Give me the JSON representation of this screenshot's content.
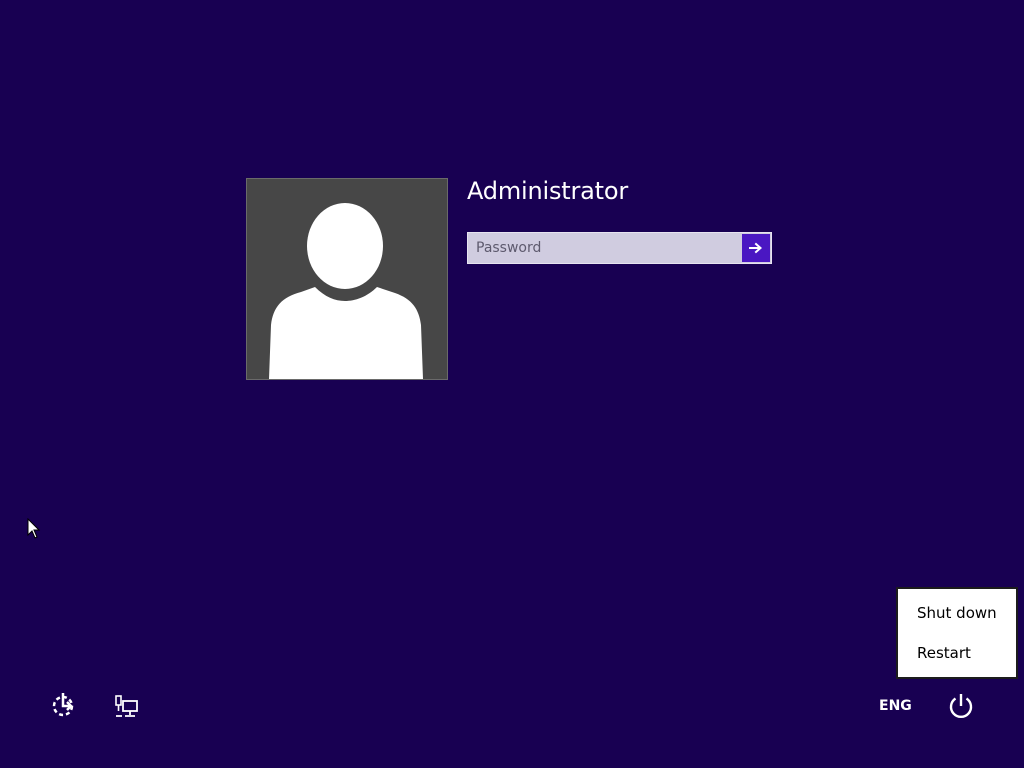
{
  "user": {
    "name": "Administrator",
    "avatar_icon": "user-silhouette-icon"
  },
  "password": {
    "value": "",
    "placeholder": "Password",
    "submit_icon": "arrow-right-icon"
  },
  "power_menu": {
    "items": [
      {
        "label": "Shut down"
      },
      {
        "label": "Restart"
      }
    ]
  },
  "bottom_bar": {
    "ease_of_access_icon": "ease-of-access-icon",
    "network_icon": "network-icon",
    "language": "ENG",
    "power_icon": "power-icon"
  },
  "colors": {
    "background": "#180052",
    "accent": "#4a17c2",
    "avatar_bg": "#474747"
  }
}
